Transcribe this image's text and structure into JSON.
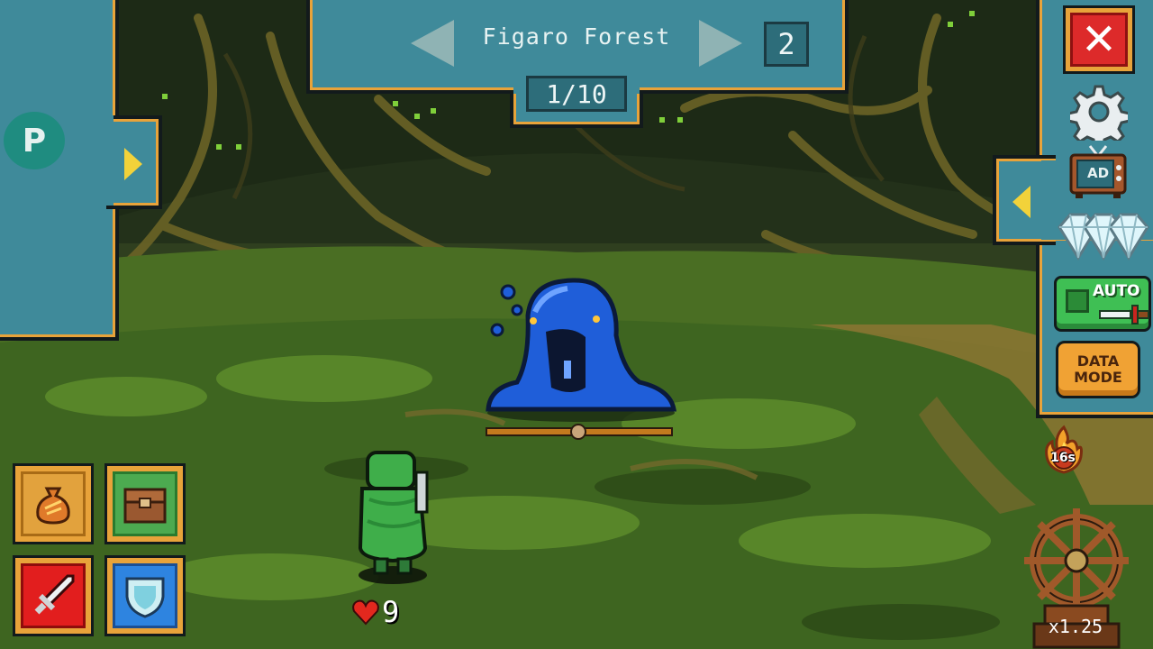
{
  "stage": {
    "name": "Figaro Forest",
    "level": "2",
    "wave": "1/10"
  },
  "left_drawer": {
    "badge": "P"
  },
  "right_panel": {
    "ad_label": "AD",
    "auto_label": "AUTO",
    "data_mode_line1": "DATA",
    "data_mode_line2": "MODE"
  },
  "buff": {
    "timer": "16s"
  },
  "speed": {
    "multiplier": "x1.25"
  },
  "hero": {
    "hp": "9"
  },
  "colors": {
    "panel_teal": "#3f8a9a",
    "panel_border_orange": "#e8a33a",
    "slime_blue": "#1f5ed9",
    "hero_green": "#3fae4a",
    "close_red": "#dd2a2a",
    "auto_green": "#3fbf54",
    "data_mode_orange": "#f0a234"
  },
  "icons": {
    "close": "close-icon",
    "settings": "gear-icon",
    "ad": "tv-ad-icon",
    "gems": "diamond-icon",
    "buff": "fire-buff-icon",
    "speed": "ship-wheel-icon",
    "bag": "coin-bag-icon",
    "chest": "treasure-chest-icon",
    "sword": "sword-icon",
    "shield": "shield-icon",
    "heart": "heart-icon"
  }
}
